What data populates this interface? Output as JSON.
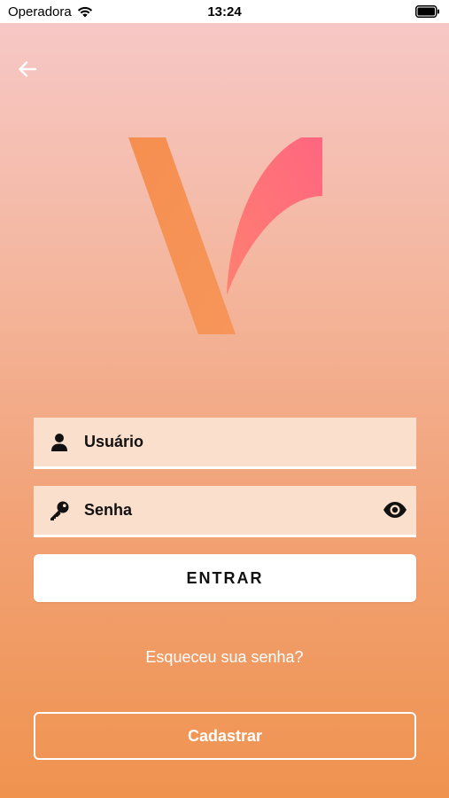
{
  "status_bar": {
    "carrier": "Operadora",
    "time": "13:24"
  },
  "icons": {
    "back": "arrow-left-icon",
    "user": "user-icon",
    "key": "key-icon",
    "eye": "eye-icon",
    "wifi": "wifi-icon",
    "battery": "battery-icon"
  },
  "login": {
    "username_placeholder": "Usuário",
    "password_placeholder": "Senha",
    "enter_label": "ENTRAR",
    "forgot_label": "Esqueceu sua senha?",
    "register_label": "Cadastrar"
  },
  "colors": {
    "gradient_top": "#f7c9c9",
    "gradient_bottom": "#ef934f",
    "logo_orange": "#f58a4e",
    "logo_pink": "#ff6b7a",
    "field_bg": "#fbdfcd"
  }
}
